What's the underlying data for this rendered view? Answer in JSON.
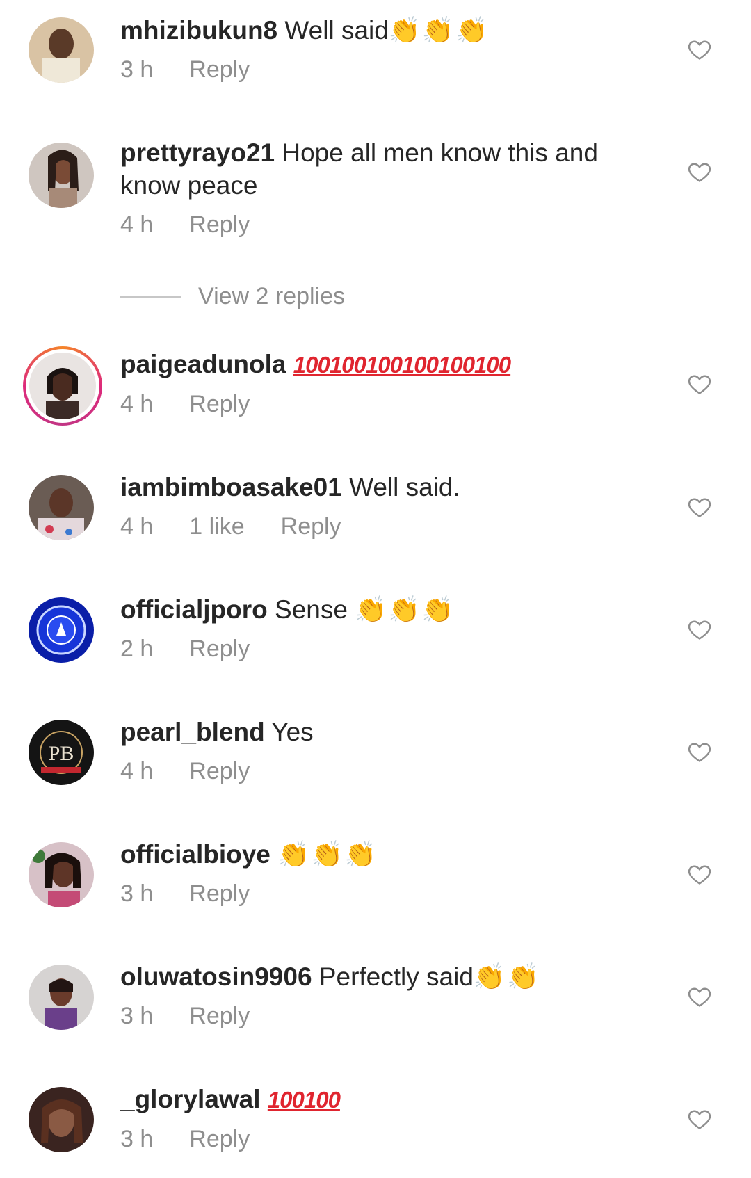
{
  "comments": [
    {
      "username": "mhizibukun8",
      "text": " Well said",
      "emoji": "👏👏👏",
      "time": "3 h",
      "likes": "",
      "reply": "Reply"
    },
    {
      "username": "prettyrayo21",
      "text": " Hope all men know this and know peace",
      "emoji": "",
      "time": "4 h",
      "likes": "",
      "reply": "Reply"
    },
    {
      "username": "paigeadunola",
      "text": " ",
      "hundred": "100100100100100100",
      "time": "4 h",
      "likes": "",
      "reply": "Reply"
    },
    {
      "username": "iambimboasake01",
      "text": " Well said.",
      "emoji": "",
      "time": "4 h",
      "likes": "1 like",
      "reply": "Reply"
    },
    {
      "username": "officialjporo",
      "text": " Sense ",
      "emoji": "👏👏👏",
      "time": "2 h",
      "likes": "",
      "reply": "Reply"
    },
    {
      "username": "pearl_blend",
      "text": " Yes",
      "emoji": "",
      "time": "4 h",
      "likes": "",
      "reply": "Reply"
    },
    {
      "username": "officialbioye",
      "text": " ",
      "emoji": "👏👏👏",
      "time": "3 h",
      "likes": "",
      "reply": "Reply"
    },
    {
      "username": "oluwatosin9906",
      "text": " Perfectly said",
      "emoji": "👏👏",
      "time": "3 h",
      "likes": "",
      "reply": "Reply"
    },
    {
      "username": "_glorylawal",
      "text": " ",
      "hundred": "100100",
      "time": "3 h",
      "likes": "",
      "reply": "Reply"
    }
  ],
  "view_replies": "View 2 replies",
  "avatar_badges": {
    "pearl_blend": "PB"
  },
  "icons": {
    "like": "heart-outline-icon"
  },
  "colors": {
    "text": "#262626",
    "meta": "#8e8e8e",
    "story_ring": "#dd2a7b",
    "hundred": "#e0252f"
  }
}
